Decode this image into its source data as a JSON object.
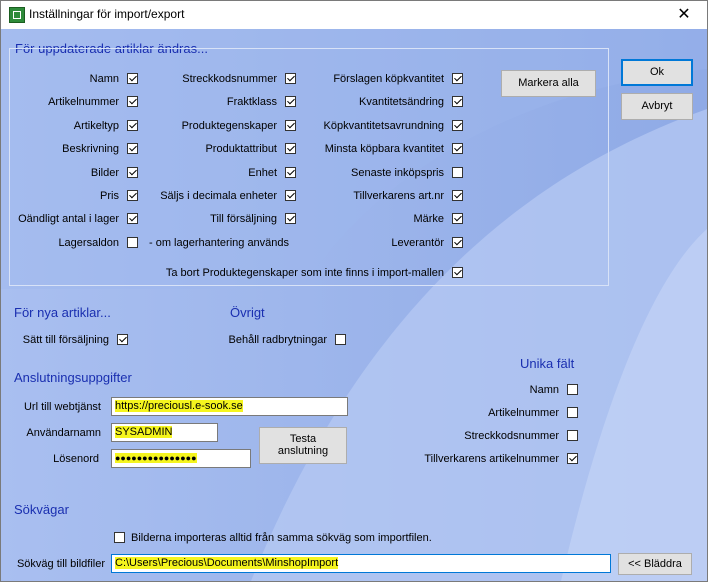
{
  "window": {
    "title": "Inställningar för import/export",
    "close_glyph": "✕"
  },
  "updated": {
    "heading": "För uppdaterade artiklar ändras...",
    "col1": [
      {
        "label": "Namn",
        "checked": true
      },
      {
        "label": "Artikelnummer",
        "checked": true
      },
      {
        "label": "Artikeltyp",
        "checked": true
      },
      {
        "label": "Beskrivning",
        "checked": true
      },
      {
        "label": "Bilder",
        "checked": true
      },
      {
        "label": "Pris",
        "checked": true
      },
      {
        "label": "Oändligt antal i lager",
        "checked": true
      },
      {
        "label": "Lagersaldon",
        "checked": false
      }
    ],
    "col2": [
      {
        "label": "Streckkodsnummer",
        "checked": true
      },
      {
        "label": "Fraktklass",
        "checked": true
      },
      {
        "label": "Produktegenskaper",
        "checked": true
      },
      {
        "label": "Produktattribut",
        "checked": true
      },
      {
        "label": "Enhet",
        "checked": true
      },
      {
        "label": "Säljs i decimala enheter",
        "checked": true
      },
      {
        "label": "Till försäljning",
        "checked": true
      }
    ],
    "col3": [
      {
        "label": "Förslagen köpkvantitet",
        "checked": true
      },
      {
        "label": "Kvantitetsändring",
        "checked": true
      },
      {
        "label": "Köpkvantitetsavrundning",
        "checked": true
      },
      {
        "label": "Minsta köpbara kvantitet",
        "checked": true
      },
      {
        "label": "Senaste inköpspris",
        "checked": false
      },
      {
        "label": "Tillverkarens art.nr",
        "checked": true
      },
      {
        "label": "Märke",
        "checked": true
      },
      {
        "label": "Leverantör",
        "checked": true
      }
    ],
    "lagersaldon_note": "- om lagerhantering används",
    "remove_props": {
      "label": "Ta bort Produktegenskaper som inte finns i import-mallen",
      "checked": true
    },
    "select_all_label": "Markera alla"
  },
  "buttons": {
    "ok": "Ok",
    "cancel": "Avbryt"
  },
  "new_articles": {
    "heading": "För nya artiklar...",
    "set_for_sale": {
      "label": "Sätt till försäljning",
      "checked": true
    }
  },
  "other": {
    "heading": "Övrigt",
    "keep_linebreaks": {
      "label": "Behåll radbrytningar",
      "checked": false
    }
  },
  "connection": {
    "heading": "Anslutningsuppgifter",
    "url_label": "Url till webtjänst",
    "url_value": "https://preciousl.e-sook.se",
    "user_label": "Användarnamn",
    "user_value": "SYSADMIN",
    "password_label": "Lösenord",
    "password_value": "●●●●●●●●●●●●●●●",
    "test_label_1": "Testa",
    "test_label_2": "anslutning"
  },
  "unique": {
    "heading": "Unika fält",
    "items": [
      {
        "label": "Namn",
        "checked": false
      },
      {
        "label": "Artikelnummer",
        "checked": false
      },
      {
        "label": "Streckkodsnummer",
        "checked": false
      },
      {
        "label": "Tillverkarens artikelnummer",
        "checked": true
      }
    ]
  },
  "paths": {
    "heading": "Sökvägar",
    "same_path": {
      "label": "Bilderna importeras alltid från samma sökväg som importfilen.",
      "checked": false
    },
    "image_path_label": "Sökväg till bildfiler",
    "image_path_value": "C:\\Users\\Precious\\Documents\\MinshopImport",
    "browse_label": "<< Bläddra"
  }
}
